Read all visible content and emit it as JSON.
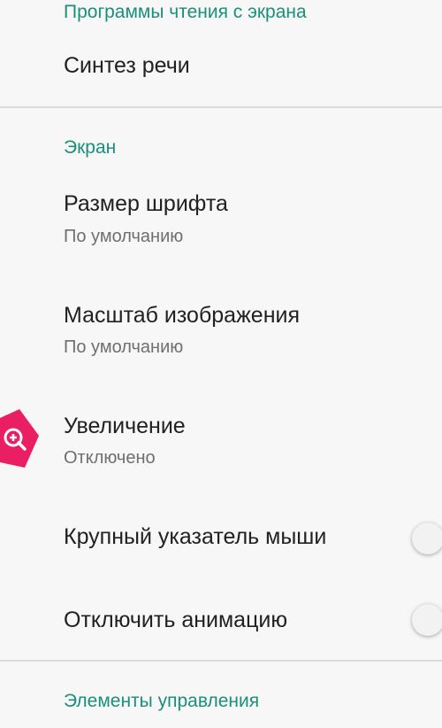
{
  "sections": {
    "screen_readers": "Программы чтения с экрана",
    "display": "Экран",
    "interaction": "Элементы управления"
  },
  "items": {
    "tts": {
      "title": "Синтез речи"
    },
    "font_size": {
      "title": "Размер шрифта",
      "summary": "По умолчанию"
    },
    "display_size": {
      "title": "Масштаб изображения",
      "summary": "По умолчанию"
    },
    "magnification": {
      "title": "Увеличение",
      "summary": "Отключено",
      "icon": "magnify-icon",
      "icon_color": "#e91e63"
    },
    "large_pointer": {
      "title": "Крупный указатель мыши",
      "checked": false
    },
    "remove_animations": {
      "title": "Отключить анимацию",
      "checked": false
    }
  },
  "colors": {
    "accent": "#1a8f7a",
    "background": "#f7f7f7",
    "divider": "#dadada"
  }
}
